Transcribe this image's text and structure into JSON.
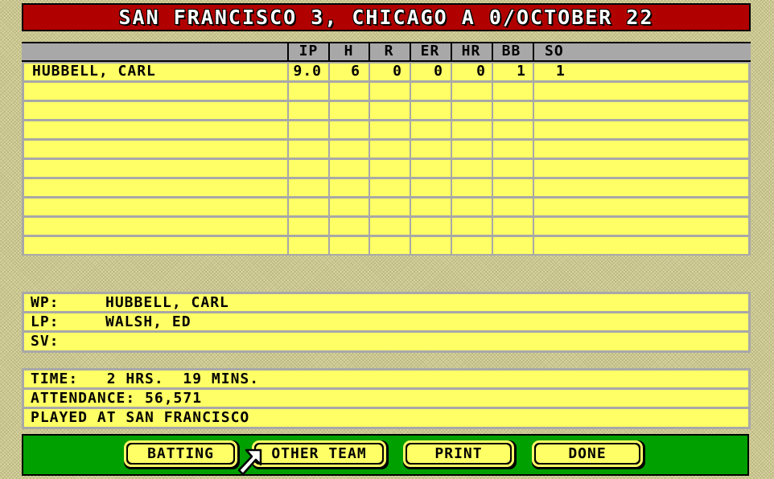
{
  "title": "SAN FRANCISCO 3, CHICAGO A 0/OCTOBER 22",
  "pitching_table": {
    "columns": [
      "IP",
      "H",
      "R",
      "ER",
      "HR",
      "BB",
      "SO"
    ],
    "rows": [
      {
        "name": "HUBBELL, CARL",
        "ip": "9.0",
        "h": "6",
        "r": "0",
        "er": "0",
        "hr": "0",
        "bb": "1",
        "so": "1"
      }
    ]
  },
  "decisions": {
    "wp_label": "WP:",
    "wp_value": "HUBBELL, CARL",
    "lp_label": "LP:",
    "lp_value": "WALSH, ED",
    "sv_label": "SV:",
    "sv_value": ""
  },
  "game_info": {
    "time": "TIME:   2 HRS.  19 MINS.",
    "attendance": "ATTENDANCE: 56,571",
    "played_at": "PLAYED AT SAN FRANCISCO"
  },
  "buttons": {
    "batting": "BATTING",
    "other_team": "OTHER TEAM",
    "print": "PRINT",
    "done": "DONE"
  },
  "colors": {
    "title_bg": "#b00000",
    "cell_bg": "#ffff66",
    "grid": "#a8a8a8",
    "footer_bg": "#00a000"
  }
}
